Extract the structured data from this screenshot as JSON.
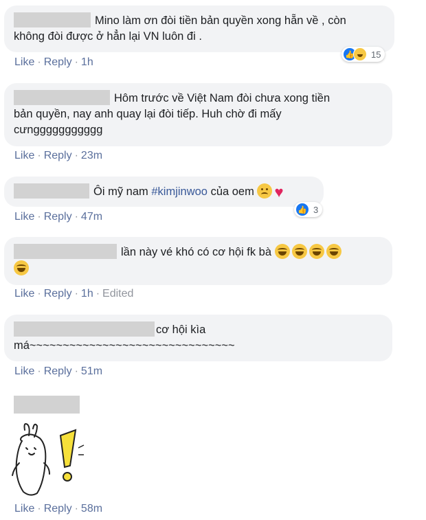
{
  "actions": {
    "like": "Like",
    "reply": "Reply",
    "sep": "·",
    "edited": "Edited"
  },
  "comments": [
    {
      "text1": "Mino làm ơn đòi tiền bản quyền xong hẵn về , còn",
      "text2": "không đòi được ở hẳn lại VN luôn đi .",
      "time": "1h",
      "reactions": "15"
    },
    {
      "text1": "Hôm trước về Việt Nam đòi chưa xong tiền",
      "text2": "bản quyền, nay anh quay lại đòi tiếp. Huh chờ đi mấy",
      "text3": "cưnggggggggggg",
      "time": "23m"
    },
    {
      "text1": "Ôi mỹ nam ",
      "hashtag": "#kimjinwoo",
      "text2": " của oem",
      "time": "47m",
      "reactions": "3"
    },
    {
      "text1": "lần này vé khó có cơ hội fk bà",
      "time": "1h"
    },
    {
      "text1": "cơ hội kìa",
      "text2": "má~~~~~~~~~~~~~~~~~~~~~~~~~~~~~~~",
      "time": "51m"
    },
    {
      "time": "58m"
    }
  ],
  "colors": {
    "link": "#5a6f9c",
    "bubble": "#f2f3f5",
    "like_blue": "#1877f2",
    "heart": "#e0245e"
  },
  "icons": [
    "like-reaction-icon",
    "haha-reaction-icon",
    "laughing-emoji-icon",
    "sad-emoji-icon",
    "heart-icon"
  ]
}
